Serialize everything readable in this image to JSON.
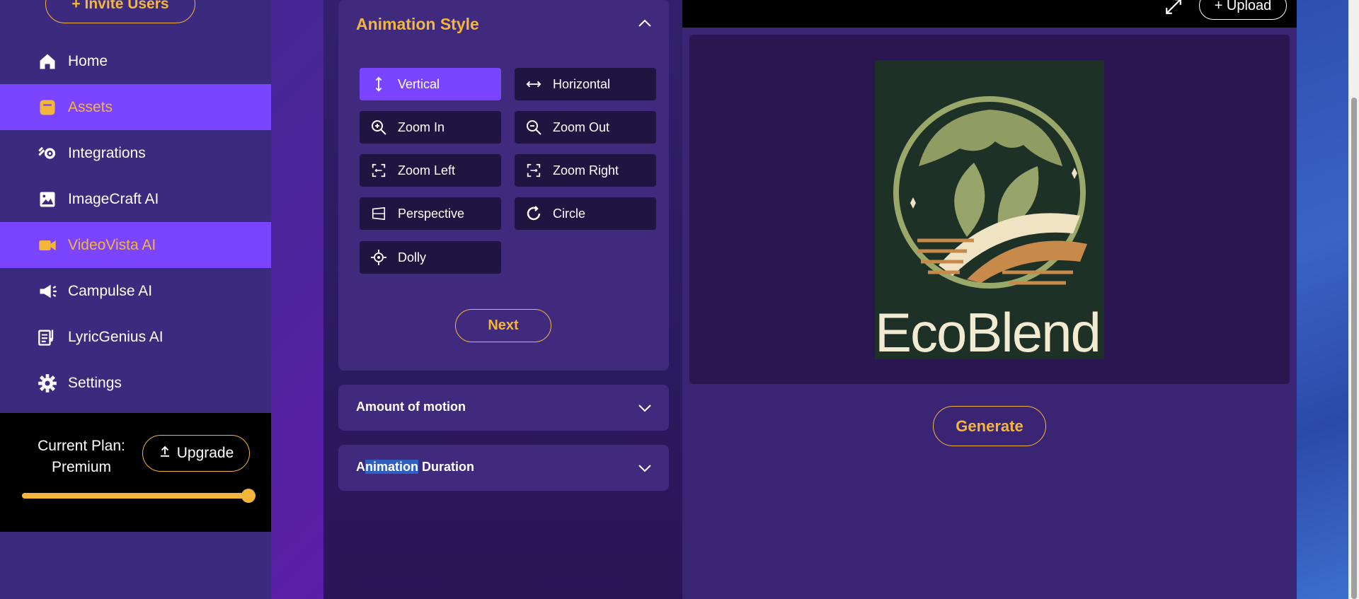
{
  "sidebar": {
    "invite_label": "+ Invite Users",
    "items": [
      {
        "label": "Home",
        "icon": "home-icon",
        "active": false
      },
      {
        "label": "Assets",
        "icon": "assets-icon",
        "active": true
      },
      {
        "label": "Integrations",
        "icon": "integrations-icon",
        "active": false
      },
      {
        "label": "ImageCraft AI",
        "icon": "image-icon",
        "active": false
      },
      {
        "label": "VideoVista AI",
        "icon": "video-icon",
        "active": true
      },
      {
        "label": "Campulse AI",
        "icon": "megaphone-icon",
        "active": false
      },
      {
        "label": "LyricGenius AI",
        "icon": "lyric-icon",
        "active": false
      },
      {
        "label": "Settings",
        "icon": "gear-icon",
        "active": false
      }
    ],
    "plan_line1": "Current Plan:",
    "plan_line2": "Premium",
    "upgrade_label": "Upgrade",
    "plan_usage": 1.0
  },
  "animation_style": {
    "title": "Animation Style",
    "options": [
      {
        "label": "Vertical",
        "icon": "vertical-arrows-icon",
        "selected": true
      },
      {
        "label": "Horizontal",
        "icon": "horizontal-arrows-icon",
        "selected": false
      },
      {
        "label": "Zoom In",
        "icon": "zoom-in-icon",
        "selected": false
      },
      {
        "label": "Zoom Out",
        "icon": "zoom-out-icon",
        "selected": false
      },
      {
        "label": "Zoom Left",
        "icon": "zoom-left-icon",
        "selected": false
      },
      {
        "label": "Zoom Right",
        "icon": "zoom-right-icon",
        "selected": false
      },
      {
        "label": "Perspective",
        "icon": "perspective-icon",
        "selected": false
      },
      {
        "label": "Circle",
        "icon": "circle-arrow-icon",
        "selected": false
      },
      {
        "label": "Dolly",
        "icon": "dolly-icon",
        "selected": false
      }
    ],
    "next_label": "Next"
  },
  "motion": {
    "title": "Amount of motion"
  },
  "duration": {
    "title_highlight": "nimation",
    "title_prefix": "A",
    "title_rest": " Duration"
  },
  "preview": {
    "upload_label": "+ Upload",
    "generate_label": "Generate",
    "logo_text": "EcoBlend"
  },
  "colors": {
    "accent": "#f4b63a",
    "active_bg": "#7b45ff",
    "panel": "#3f2a7d"
  }
}
